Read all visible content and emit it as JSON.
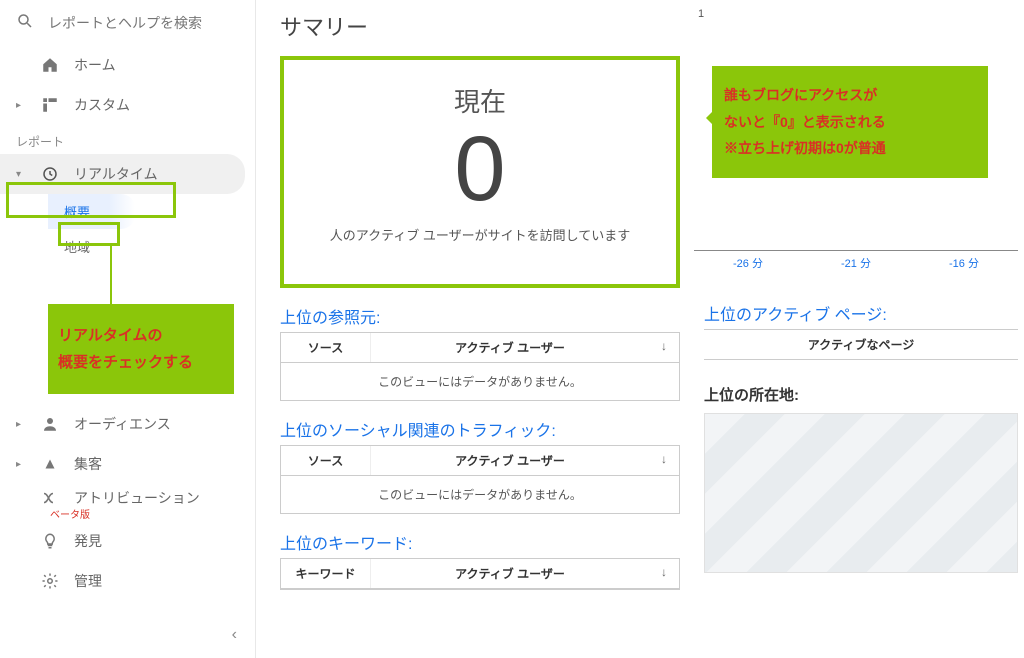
{
  "search": {
    "placeholder": "レポートとヘルプを検索"
  },
  "sidebar": {
    "home": "ホーム",
    "custom": "カスタム",
    "section_report": "レポート",
    "realtime": "リアルタイム",
    "sub_overview": "概要",
    "sub_region": "地域",
    "audience": "オーディエンス",
    "acquisition": "集客",
    "attribution": "アトリビューション",
    "beta": "ベータ版",
    "discover": "発見",
    "admin": "管理"
  },
  "main": {
    "title": "サマリー",
    "now_label": "現在",
    "now_value": "0",
    "now_sub": "人のアクティブ ユーザーがサイトを訪問しています",
    "timeaxis": [
      "-26 分",
      "-21 分",
      "-16 分"
    ],
    "one_mark": "1",
    "panels": {
      "referral": {
        "title": "上位の参照元:",
        "c1": "ソース",
        "c2": "アクティブ ユーザー",
        "empty": "このビューにはデータがありません。"
      },
      "social": {
        "title": "上位のソーシャル関連のトラフィック:",
        "c1": "ソース",
        "c2": "アクティブ ユーザー",
        "empty": "このビューにはデータがありません。"
      },
      "keyword": {
        "title": "上位のキーワード:",
        "c1": "キーワード",
        "c2": "アクティブ ユーザー"
      },
      "active_pages": {
        "title": "上位のアクティブ ページ:",
        "head": "アクティブなページ"
      },
      "location": {
        "title": "上位の所在地:"
      }
    }
  },
  "annotations": {
    "left_l1": "リアルタイムの",
    "left_l2": "概要をチェックする",
    "right_l1": "誰もブログにアクセスが",
    "right_l2": "ないと『0』と表示される",
    "right_l3": "※立ち上げ初期は0が普通"
  }
}
